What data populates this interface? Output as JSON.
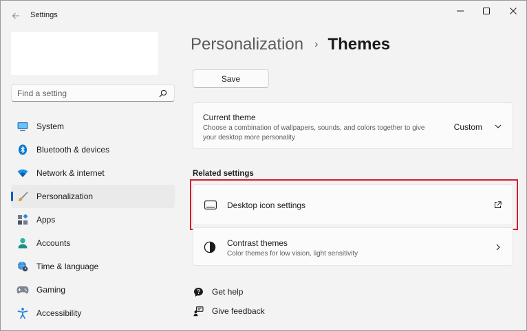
{
  "app": {
    "title": "Settings"
  },
  "search": {
    "placeholder": "Find a setting"
  },
  "sidebar": {
    "items": [
      {
        "label": "System",
        "icon": "monitor-icon"
      },
      {
        "label": "Bluetooth & devices",
        "icon": "bluetooth-icon"
      },
      {
        "label": "Network & internet",
        "icon": "wifi-icon"
      },
      {
        "label": "Personalization",
        "icon": "brush-icon",
        "active": true
      },
      {
        "label": "Apps",
        "icon": "apps-icon"
      },
      {
        "label": "Accounts",
        "icon": "person-icon"
      },
      {
        "label": "Time & language",
        "icon": "globe-clock-icon"
      },
      {
        "label": "Gaming",
        "icon": "gamepad-icon"
      },
      {
        "label": "Accessibility",
        "icon": "accessibility-icon"
      }
    ]
  },
  "breadcrumb": {
    "parent": "Personalization",
    "separator": "›",
    "current": "Themes"
  },
  "save_label": "Save",
  "current_theme": {
    "title": "Current theme",
    "desc_line1": "Choose a combination of wallpapers, sounds, and colors together to give",
    "desc_line2": "your desktop more personality",
    "value": "Custom"
  },
  "related": {
    "label": "Related settings",
    "desktop_icons": {
      "title": "Desktop icon settings"
    },
    "contrast": {
      "title": "Contrast themes",
      "desc": "Color themes for low vision, light sensitivity"
    }
  },
  "links": {
    "help": "Get help",
    "feedback": "Give feedback"
  },
  "colors": {
    "accent": "#005fb8",
    "highlight": "#d51c2b"
  }
}
